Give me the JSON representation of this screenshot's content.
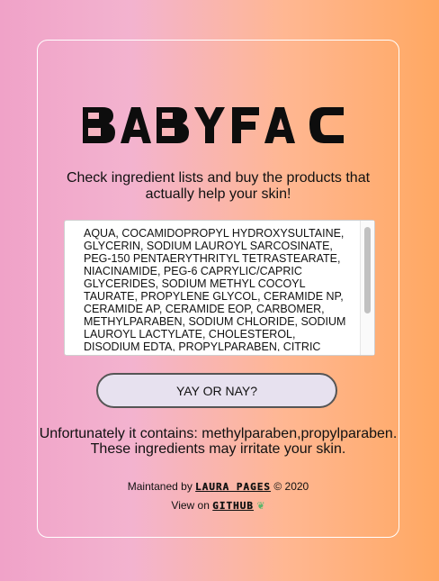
{
  "brand": {
    "name": "BABYFACE"
  },
  "tagline": "Check ingredient lists and buy the products that actually help your skin!",
  "ingredients": {
    "value": "AQUA, COCAMIDOPROPYL HYDROXYSULTAINE,\nGLYCERIN, SODIUM LAUROYL SARCOSINATE,\nPEG-150 PENTAERYTHRITYL TETRASTEARATE,\nNIACINAMIDE, PEG-6 CAPRYLIC/CAPRIC\nGLYCERIDES, SODIUM METHYL COCOYL\nTAURATE, PROPYLENE GLYCOL, CERAMIDE NP,\nCERAMIDE AP, CERAMIDE EOP, CARBOMER,\nMETHYLPARABEN, SODIUM CHLORIDE, SODIUM\nLAUROYL LACTYLATE, CHOLESTEROL,\nDISODIUM EDTA, PROPYLPARABEN, CITRIC"
  },
  "check_button": {
    "label": "YAY OR NAY?"
  },
  "result": {
    "line1": "Unfortunately it contains: methylparaben,propylparaben.",
    "line2": "These ingredients may irritate your skin."
  },
  "footer": {
    "maintained_prefix": "Maintaned by",
    "author": "LAURA PAGES",
    "year_text": "© 2020",
    "view_prefix": "View on",
    "github": "GITHUB",
    "github_icon": "sprout-icon"
  },
  "colors": {
    "gradient_left": "#f0a2c8",
    "gradient_right": "#ffa862",
    "button_bg": "#e7e1ef"
  }
}
